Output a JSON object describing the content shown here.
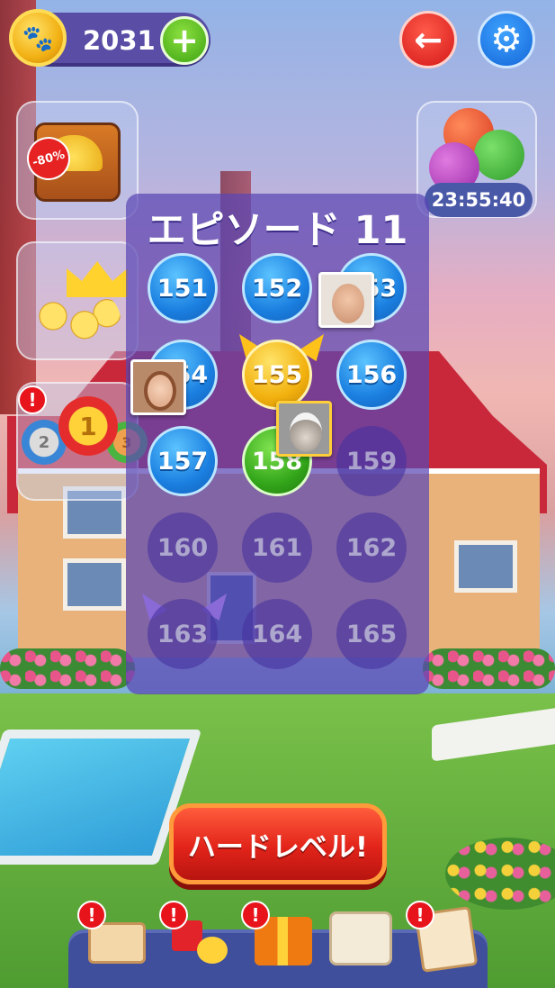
{
  "header": {
    "coins": "2031",
    "coin_icon": "paw-coin-icon",
    "add_label": "+"
  },
  "side_tiles": {
    "chest_discount": "-80%",
    "timer": "23:55:40",
    "alert_mark": "!",
    "medal_first": "1",
    "medal_second": "2",
    "medal_third": "3"
  },
  "episode": {
    "title": "エピソード 11",
    "levels": [
      "151",
      "152",
      "153",
      "154",
      "155",
      "156",
      "157",
      "158",
      "159",
      "160",
      "161",
      "162",
      "163",
      "164",
      "165"
    ],
    "current_level": "155"
  },
  "hard_level_button": "ハードレベル!",
  "bottom_nav": {
    "items": [
      "mail-icon",
      "toy-blocks-icon",
      "gift-box-icon",
      "store-icon",
      "task-list-icon"
    ],
    "alert_mark": "!"
  },
  "colors": {
    "panel": "#5a46b4",
    "level_done": "#1a7fe0",
    "level_current": "#f2b10e",
    "hard_button": "#e2241a"
  }
}
